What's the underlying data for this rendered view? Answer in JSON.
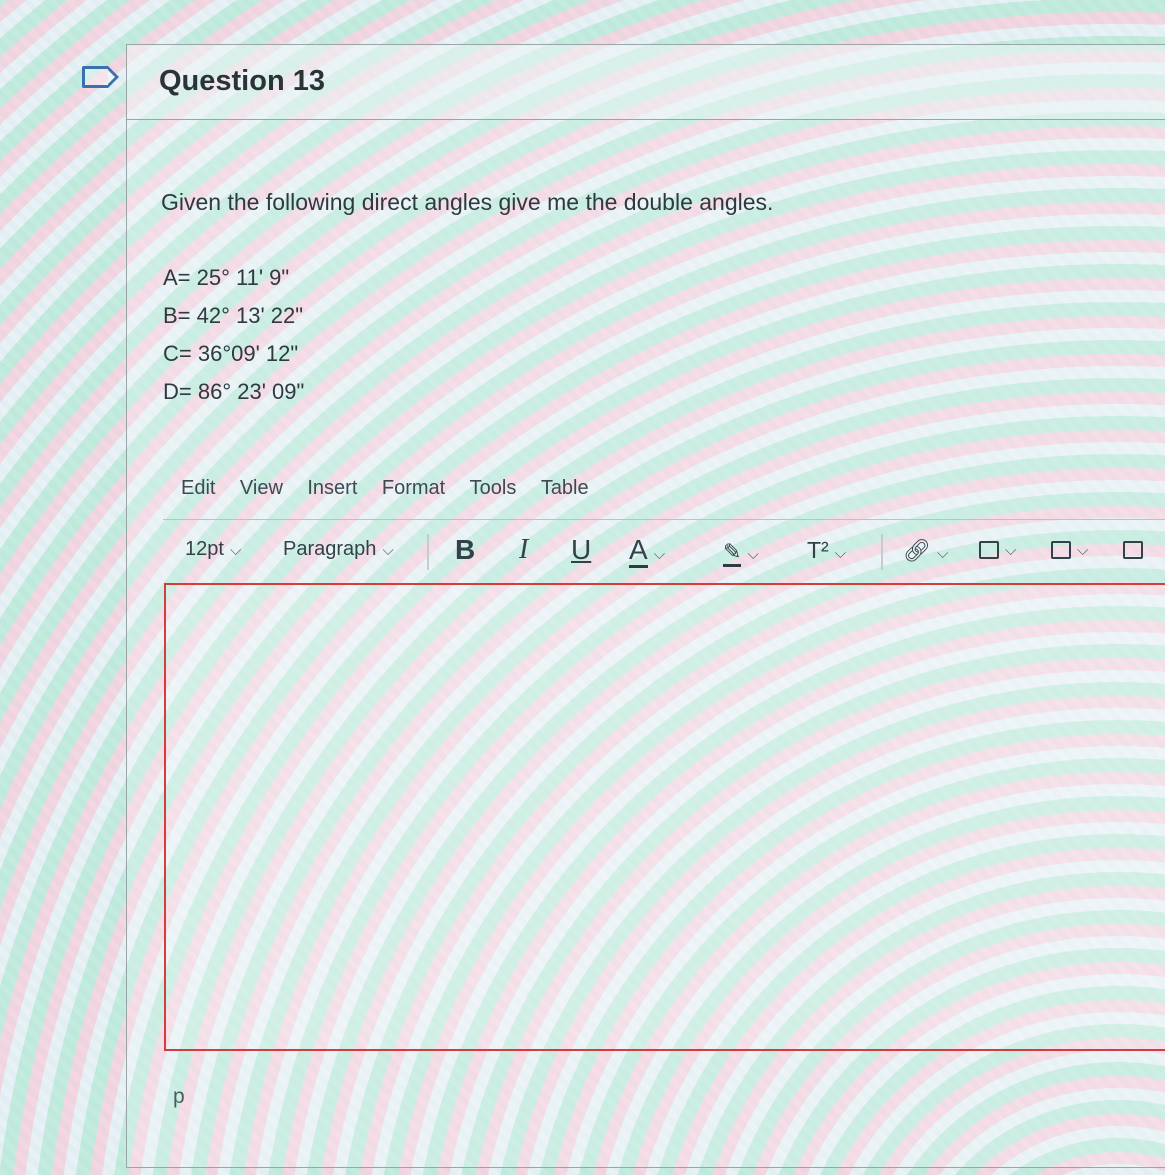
{
  "question": {
    "title": "Question 13",
    "prompt": "Given the following direct angles give me the double angles.",
    "angles": [
      "A= 25° 11' 9\"",
      "B= 42° 13' 22\"",
      "C= 36°09' 12\"",
      "D= 86° 23' 09\""
    ]
  },
  "editor": {
    "menu": [
      "Edit",
      "View",
      "Insert",
      "Format",
      "Tools",
      "Table"
    ],
    "toolbar": {
      "font_size": "12pt",
      "block_format": "Paragraph",
      "bold": "B",
      "italic": "I",
      "underline": "U",
      "text_color": "A",
      "superscript": "T²"
    },
    "status_path": "p",
    "border_color": "#d63c3c"
  },
  "icons": [
    "flag-icon",
    "highlight-icon",
    "link-icon",
    "image-icon",
    "media-icon",
    "document-icon",
    "chevron-down-icon"
  ]
}
